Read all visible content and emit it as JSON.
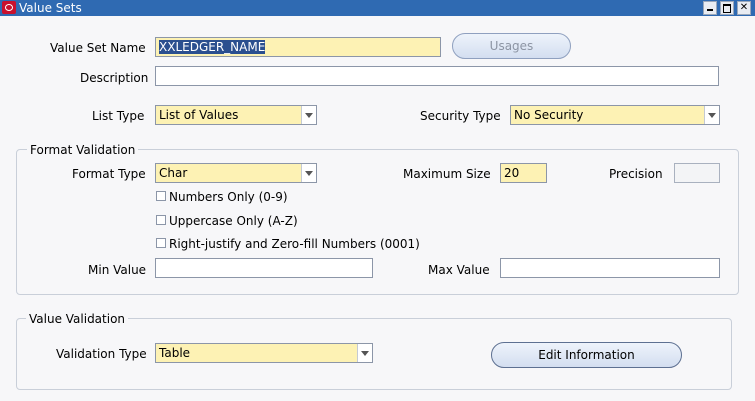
{
  "window": {
    "title": "Value Sets",
    "controls": [
      "minimize-icon",
      "maximize-icon",
      "close-icon"
    ]
  },
  "fields": {
    "value_set_name": {
      "label": "Value Set Name",
      "value": "XXLEDGER_NAME"
    },
    "description": {
      "label": "Description",
      "value": ""
    },
    "list_type": {
      "label": "List Type",
      "value": "List of Values"
    },
    "security_type": {
      "label": "Security Type",
      "value": "No Security"
    }
  },
  "buttons": {
    "usages": "Usages",
    "edit_information": "Edit Information"
  },
  "format_validation": {
    "title": "Format Validation",
    "format_type": {
      "label": "Format Type",
      "value": "Char"
    },
    "maximum_size": {
      "label": "Maximum Size",
      "value": "20"
    },
    "precision": {
      "label": "Precision",
      "value": ""
    },
    "checkboxes": [
      {
        "label": "Numbers Only (0-9)",
        "checked": false
      },
      {
        "label": "Uppercase Only (A-Z)",
        "checked": false
      },
      {
        "label": "Right-justify and Zero-fill Numbers (0001)",
        "checked": false
      }
    ],
    "min_value": {
      "label": "Min Value",
      "value": ""
    },
    "max_value": {
      "label": "Max Value",
      "value": ""
    }
  },
  "value_validation": {
    "title": "Value Validation",
    "validation_type": {
      "label": "Validation Type",
      "value": "Table"
    }
  },
  "colors": {
    "titlebar": "#2f6ab2",
    "required_field": "#fdf2b4",
    "selection": "#2b4f8f"
  }
}
